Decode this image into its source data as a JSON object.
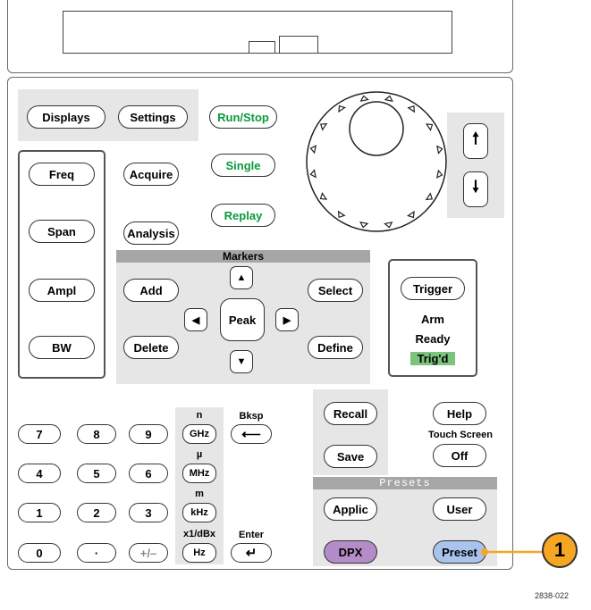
{
  "hardkeys": {
    "displays": "Displays",
    "settings": "Settings",
    "run_stop": "Run/Stop",
    "single": "Single",
    "replay": "Replay",
    "freq": "Freq",
    "span": "Span",
    "ampl": "Ampl",
    "bw": "BW",
    "acquire": "Acquire",
    "analysis": "Analysis"
  },
  "markers": {
    "title": "Markers",
    "add": "Add",
    "select": "Select",
    "peak": "Peak",
    "delete": "Delete",
    "define": "Define",
    "up": "▲",
    "down": "▼",
    "left": "◀",
    "right": "▶"
  },
  "knob": {
    "up_arrow": "🠕",
    "down_arrow": "🠗"
  },
  "trigger": {
    "button": "Trigger",
    "arm": "Arm",
    "ready": "Ready",
    "trigd": "Trig'd"
  },
  "keypad": {
    "digits": [
      "7",
      "8",
      "9",
      "4",
      "5",
      "6",
      "1",
      "2",
      "3",
      "0",
      "·",
      "+/–"
    ],
    "unit_prefixes": [
      "n",
      "µ",
      "m",
      "x1/dBx"
    ],
    "units": [
      "GHz",
      "MHz",
      "kHz",
      "Hz"
    ],
    "bksp": "Bksp",
    "enter": "Enter",
    "bksp_arrow": "⟵",
    "enter_arrow": "↵"
  },
  "misc": {
    "recall": "Recall",
    "save": "Save",
    "help": "Help",
    "touch_screen": "Touch Screen",
    "off": "Off"
  },
  "presets": {
    "title": "Presets",
    "applic": "Applic",
    "user": "User",
    "dpx": "DPX",
    "preset": "Preset"
  },
  "callout": {
    "number": "1"
  },
  "figure_id": "2838-022",
  "colors": {
    "green_text": "#0a9a3c",
    "trigd_bg": "#7cc47c",
    "dpx_bg": "#b48cc8",
    "preset_bg": "#a9c4ec",
    "callout_fill": "#f5a623"
  }
}
